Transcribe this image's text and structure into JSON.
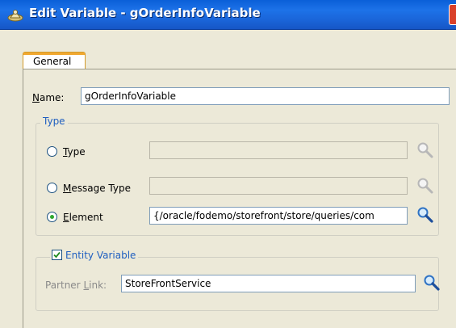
{
  "window": {
    "title": "Edit Variable - gOrderInfoVariable"
  },
  "tabs": [
    {
      "label": "General",
      "active": true
    }
  ],
  "name_field": {
    "label": "Name:",
    "mnemonic": "N",
    "value": "gOrderInfoVariable"
  },
  "type_group": {
    "legend": "Type",
    "options": [
      {
        "label": "Type",
        "mnemonic": "T",
        "selected": false,
        "value": "",
        "enabled": false,
        "search_icon": "magnifier-icon"
      },
      {
        "label": "Message Type",
        "mnemonic": "M",
        "selected": false,
        "value": "",
        "enabled": false,
        "search_icon": "magnifier-icon"
      },
      {
        "label": "Element",
        "mnemonic": "E",
        "selected": true,
        "value": "{/oracle/fodemo/storefront/store/queries/com",
        "enabled": true,
        "search_icon": "magnifier-icon"
      }
    ]
  },
  "entity_group": {
    "checkbox_label": "Entity Variable",
    "checked": true,
    "partner_link_label": "Partner Link:",
    "partner_link_mnemonic": "L",
    "partner_link_value": "StoreFrontService",
    "search_icon": "magnifier-icon"
  },
  "colors": {
    "titlebar": "#1a64d8",
    "dialog_bg": "#ece9d8",
    "group_legend": "#1f5fc0",
    "tab_accent": "#f0a830",
    "radio_dot": "#2fa82f"
  }
}
